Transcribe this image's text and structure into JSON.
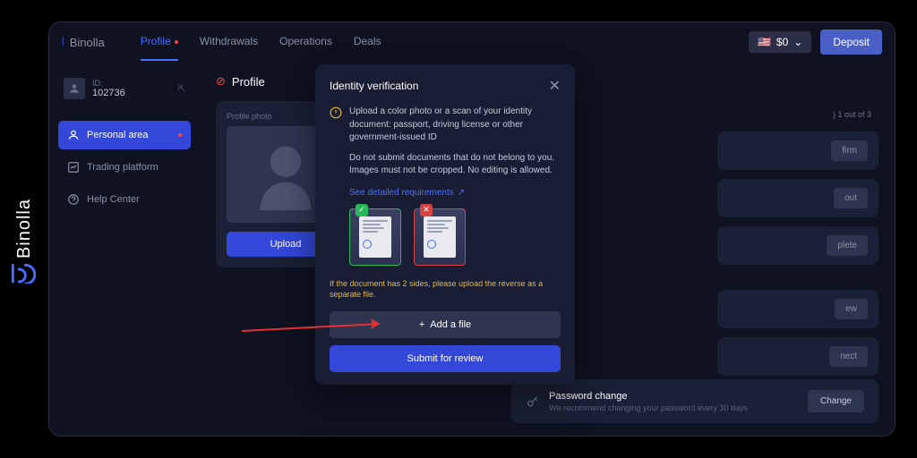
{
  "brand": "Binolla",
  "header": {
    "logo": "Binolla",
    "nav": [
      "Profile",
      "Withdrawals",
      "Operations",
      "Deals"
    ],
    "balance": "$0",
    "deposit": "Deposit"
  },
  "user": {
    "id_label": "ID:",
    "id": "102736"
  },
  "sidebar": {
    "items": [
      {
        "label": "Personal area"
      },
      {
        "label": "Trading platform"
      },
      {
        "label": "Help Center"
      }
    ]
  },
  "profile": {
    "title": "Profile",
    "photo_label": "Profile photo",
    "upload": "Upload"
  },
  "modal": {
    "title": "Identity verification",
    "text1": "Upload a color photo or a scan of your identity document: passport, driving license or other government-issued ID",
    "text2": "Do not submit documents that do not belong to you. Images must not be cropped. No editing is allowed.",
    "link": "See detailed requirements",
    "note": "If the document has 2 sides, please upload the reverse as a separate file.",
    "add_file": "Add a file",
    "submit": "Submit for review"
  },
  "stubs": {
    "step": "1 out of 3",
    "b1": "firm",
    "b2": "out",
    "b3": "plete",
    "b4": "ew",
    "b5": "nect"
  },
  "pw": {
    "title": "Password change",
    "sub": "We recommend changing your password every 30 days",
    "btn": "Change"
  }
}
